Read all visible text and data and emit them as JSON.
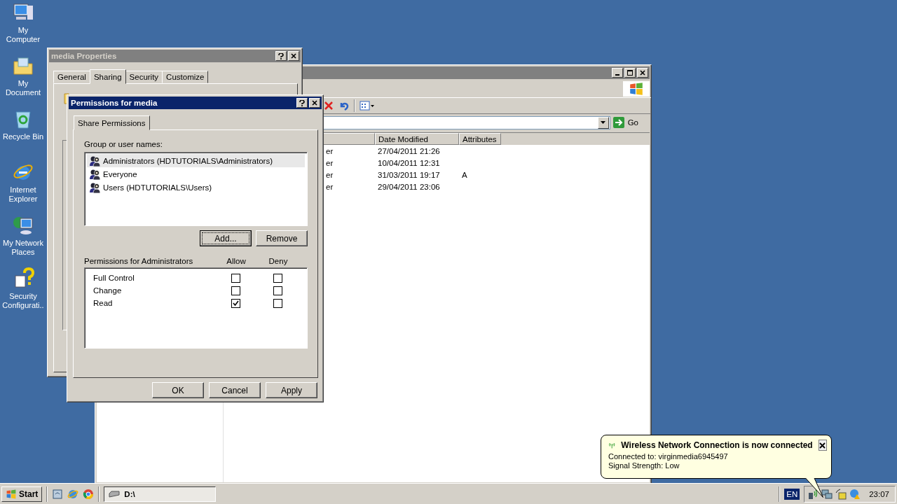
{
  "desktop_icons": [
    {
      "label": "My Computer",
      "kind": "computer"
    },
    {
      "label": "My Document",
      "kind": "documents"
    },
    {
      "label": "Recycle Bin",
      "kind": "recycle"
    },
    {
      "label": "Internet Explorer",
      "kind": "ie"
    },
    {
      "label": "My Network Places",
      "kind": "network"
    },
    {
      "label": "Security Configurati..",
      "kind": "security"
    }
  ],
  "properties_window": {
    "title": "media Properties",
    "tabs": [
      {
        "label": "General",
        "selected": false
      },
      {
        "label": "Sharing",
        "selected": true
      },
      {
        "label": "Security",
        "selected": false
      },
      {
        "label": "Customize",
        "selected": false
      }
    ]
  },
  "explorer_window": {
    "go_button": "Go",
    "columns": [
      "Date Modified",
      "Attributes"
    ],
    "rows": [
      {
        "column_1": "er",
        "date_modified": "27/04/2011 21:26",
        "attributes": ""
      },
      {
        "column_1": "er",
        "date_modified": "10/04/2011 12:31",
        "attributes": ""
      },
      {
        "column_1": "er",
        "date_modified": "31/03/2011 19:17",
        "attributes": "A"
      },
      {
        "column_1": "er",
        "date_modified": "29/04/2011 23:06",
        "attributes": ""
      }
    ]
  },
  "permissions_dialog": {
    "title": "Permissions for media",
    "tab": "Share Permissions",
    "group_label": "Group or user names:",
    "users": [
      {
        "name": "Administrators (HDTUTORIALS\\Administrators)",
        "selected": true
      },
      {
        "name": "Everyone",
        "selected": false
      },
      {
        "name": "Users (HDTUTORIALS\\Users)",
        "selected": false
      }
    ],
    "add_button": "Add...",
    "remove_button": "Remove",
    "permissions_label": "Permissions for Administrators",
    "allow_header": "Allow",
    "deny_header": "Deny",
    "permissions": [
      {
        "name": "Full Control",
        "allow": false,
        "deny": false
      },
      {
        "name": "Change",
        "allow": false,
        "deny": false
      },
      {
        "name": "Read",
        "allow": true,
        "deny": false
      }
    ],
    "buttons": [
      "OK",
      "Cancel",
      "Apply"
    ]
  },
  "balloon": {
    "title": "Wireless Network Connection is now connected",
    "lines": [
      "Connected to: virginmedia6945497",
      "Signal Strength: Low"
    ]
  },
  "taskbar": {
    "start": "Start",
    "task": "D:\\",
    "language": "EN",
    "clock": "23:07"
  }
}
